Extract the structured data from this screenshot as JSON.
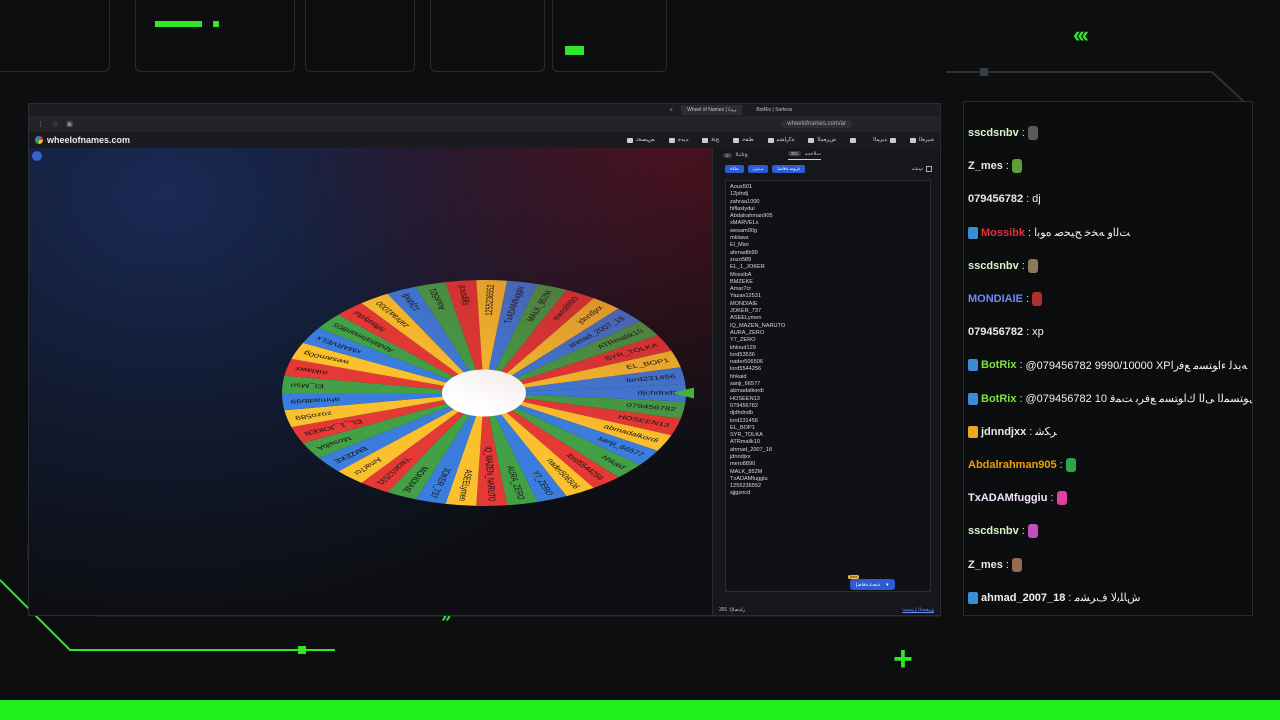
{
  "overlay": {
    "chevrons_top": "‹‹‹",
    "chevrons_bottom": "»",
    "plus_sign": "+"
  },
  "browser": {
    "tabs": [
      "Wheel of Names | ﺮﻴﺒﻛ",
      "BotRix | Sorteos"
    ],
    "url": "wheelofnames.com/ar",
    "brand": "wheelofnames.com",
    "menu": [
      "ﺺﻴﺼﺨﺗ",
      "ﺪﻳﺪﺟ",
      "ﺢﺘﻓ",
      "ﻆﻔﺣ",
      "ﺔﻛﺭﺎﺸﻣ",
      "ﺽﺮﻌﻤﻟﺍ",
      "",
      "ﺪﻳﺰﻤﻟﺍ",
      "ﺔﻴﺑﺮﻌﻟﺍ"
    ]
  },
  "panel": {
    "tab_entries": "ﺕﻼﺧﺪﻣ",
    "tab_entries_count": "391",
    "tab_results": "ﺞﺋﺎﺘﻨﻟﺍ",
    "tab_results_count": "0",
    "btn_shuffle": "ﻂﻠﺧ",
    "btn_sort": "ﺐﻴﺗﺮﺗ",
    "btn_add_image": "ﺓﺭﻮﺻ ﺔﻓﺎﺿﺇ",
    "advanced_label": "ﻡﺪﻘﺘﻣ",
    "add_button": "ﺔﺒﺠﻋ ﺔﻓﺎﺿﺇ",
    "beta": "Beta",
    "footer_link": "ﻖﻴﻘﺤﺘﻟﺍ ﻞﻴﺠﺴﺗ",
    "footer_version": "391 :ﺭﺍﺪﺻﻹﺍ",
    "entries": [
      "Aous501",
      "12jdndj",
      "zahraa1000",
      "hlflaslydui",
      "Abdalrahman905",
      "xMARVELx",
      "wesam00g",
      "mklawz",
      "El_Msri",
      "ahmadib99",
      "zozo589",
      "EL_1_JOKER",
      "MossibA",
      "BMZEKE",
      "Amar7cr",
      "Yazan12531",
      "MONDIAIE",
      "JOKER_737",
      "ASEELymen",
      "IQ_MAZEN_NARUTO",
      "AURA_ZERO",
      "Y7_ZERO",
      "khloud129",
      "lord53536",
      "nader506506",
      "lord5544256",
      "hhkaid",
      "sanji_66577",
      "abmadalkordi",
      "HOSEEN13",
      "079456782",
      "djdhdndb",
      "lord231456",
      "EL_BOP1",
      "SYR_TOLKA",
      "ATRmalik10",
      "ahmad_2007_18",
      "jdnndjxx",
      "mero8890",
      "MALK_852M",
      "TxADAMfuggiu",
      "1255236552",
      "sjjgsncd"
    ]
  },
  "wheel": {
    "labels": [
      "djchdndb",
      "079456782",
      "HOSEEN13",
      "abmadalkordi",
      "sanji_66577",
      "hhkaid",
      "lord5544256",
      "nader506506",
      "Y7_ZERO",
      "AURA_ZERO",
      "IQ_MAZEN_NARUTO",
      "ASEELymen",
      "JOKER_737",
      "MONDIAIE",
      "Yazan12531",
      "Amar7cr",
      "BMZEKE",
      "MossibA",
      "EL_1_JOKER",
      "zozo589",
      "ahmadib99",
      "El_Msri",
      "mklawz",
      "wesam00g",
      "xMARVELx",
      "Abdalrahman905",
      "hlflaslydui",
      "zahraa1000",
      "12jdndj",
      "Aous501",
      "sjjgsncd",
      "1255236552",
      "TxADAMfuggiu",
      "MALK_852M",
      "mero8890",
      "jdnndjxx",
      "ahmad_2007_18",
      "ATRmalik10",
      "SYR_TOLKA",
      "EL_BOP1",
      "lord231456"
    ],
    "colors": [
      "#3b7ddd",
      "#43a047",
      "#e53935",
      "#fbc02d"
    ]
  },
  "chat": {
    "messages": [
      {
        "name": "sscdsnbv",
        "name_color": "#d9f5c8",
        "text": "",
        "emote": "#5a5a5a"
      },
      {
        "name": "Z_mes",
        "name_color": "#e8e8e8",
        "text": "",
        "emote": "#5f9f3a"
      },
      {
        "name": "079456782",
        "name_color": "#e8e8e8",
        "text": "dj"
      },
      {
        "name": "Mossibk",
        "name_color": "#e0303a",
        "text": "ﺖﻟﺍﻭ ﻪﺨﺧ ﺢﻴﺤﺻ ﻩﻮﺑﺍ",
        "badge": "#3c8bd9"
      },
      {
        "name": "sscdsnbv",
        "name_color": "#d9f5c8",
        "text": "",
        "emote": "#8a7a5a"
      },
      {
        "name": "MONDIAIE",
        "name_color": "#6a8cff",
        "text": "",
        "emote": "#b03030"
      },
      {
        "name": "079456782",
        "name_color": "#e8e8e8",
        "text": "xp"
      },
      {
        "name": "BotRix",
        "name_color": "#7ee23a",
        "text": "@079456782 9990/10000 XPﻪﻳﺪﻟ ءﺍﻮﺘﺴﻣ ﻊﻓﺭﺍ",
        "badge": "#3c8bd9"
      },
      {
        "name": "BotRix",
        "name_color": "#7ee23a",
        "text": "@079456782 10 ﻯﻮﺘﺴﻤﻟﺍ ﻰﻟﺍ ﻙﺍﻮﺘﺴﻣ ﻊﻓﺮﺑ ﺖﻤﻗ",
        "badge": "#3c8bd9"
      },
      {
        "name": "jdnndjxx",
        "name_color": "#e8e8e8",
        "text": "ﺮﻜﺷ",
        "badge": "#e6a91c"
      },
      {
        "name": "Abdalrahman905",
        "name_color": "#f0a000",
        "text": "",
        "emote": "#2fa44a"
      },
      {
        "name": "TxADAMfuggiu",
        "name_color": "#f2e5ff",
        "text": "",
        "emote": "#e040a0"
      },
      {
        "name": "sscdsnbv",
        "name_color": "#d9f5c8",
        "text": "",
        "emote": "#c050c0"
      },
      {
        "name": "Z_mes",
        "name_color": "#e8e8e8",
        "text": "",
        "emote": "#9a6a50"
      },
      {
        "name": "ahmad_2007_18",
        "name_color": "#f1f1f1",
        "text": "ﺵﺎﻠﻳﻻ ﻑﺮﺸﻣ",
        "badge": "#3c8bd9"
      }
    ]
  }
}
